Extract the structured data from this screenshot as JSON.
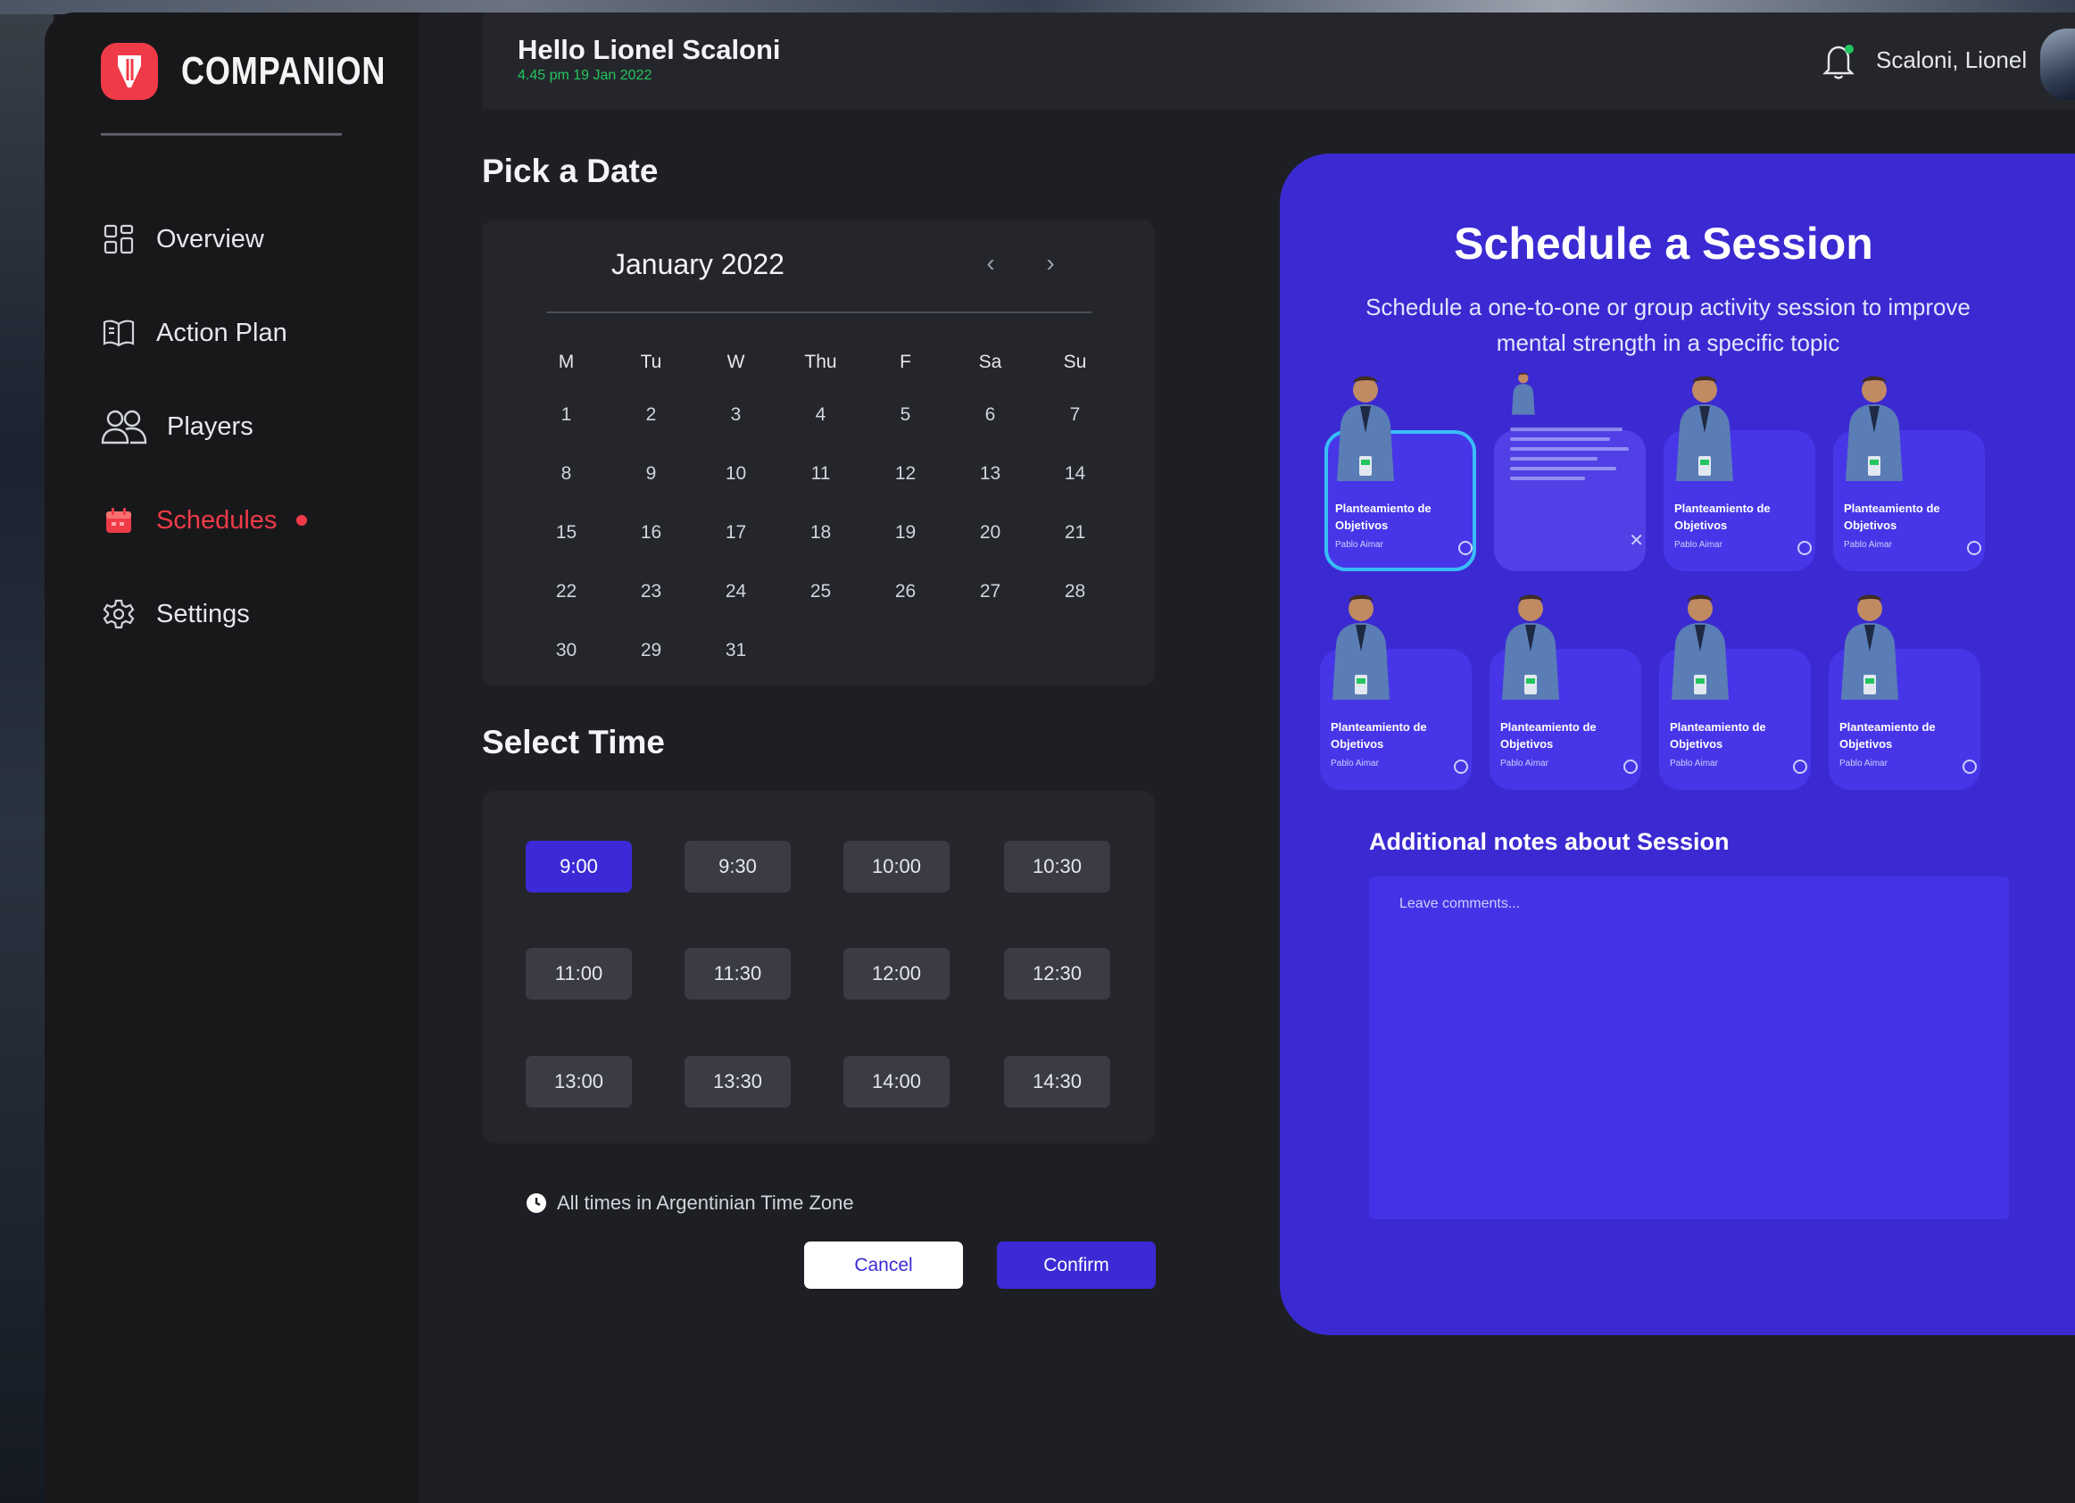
{
  "app": {
    "name": "COMPANION"
  },
  "sidebar": {
    "items": [
      {
        "label": "Overview",
        "icon": "grid-icon",
        "active": false
      },
      {
        "label": "Action Plan",
        "icon": "book-icon",
        "active": false
      },
      {
        "label": "Players",
        "icon": "users-icon",
        "active": false
      },
      {
        "label": "Schedules",
        "icon": "calendar-icon",
        "active": true
      },
      {
        "label": "Settings",
        "icon": "gear-icon",
        "active": false
      }
    ]
  },
  "header": {
    "greeting": "Hello Lionel Scaloni",
    "datetime": "4.45 pm 19 Jan 2022",
    "user_name": "Scaloni, Lionel"
  },
  "date_picker": {
    "title": "Pick a Date",
    "month": "January 2022",
    "weekdays": [
      "M",
      "Tu",
      "W",
      "Thu",
      "F",
      "Sa",
      "Su"
    ],
    "weeks": [
      [
        "1",
        "2",
        "3",
        "4",
        "5",
        "6",
        "7"
      ],
      [
        "8",
        "9",
        "10",
        "11",
        "12",
        "13",
        "14"
      ],
      [
        "15",
        "16",
        "17",
        "18",
        "19",
        "20",
        "21"
      ],
      [
        "22",
        "23",
        "24",
        "25",
        "26",
        "27",
        "28"
      ],
      [
        "30",
        "29",
        "31",
        "",
        "",
        "",
        ""
      ]
    ]
  },
  "time_picker": {
    "title": "Select Time",
    "slots": [
      "9:00",
      "9:30",
      "10:00",
      "10:30",
      "11:00",
      "11:30",
      "12:00",
      "12:30",
      "13:00",
      "13:30",
      "14:00",
      "14:30"
    ],
    "selected": "9:00",
    "timezone_note": "All times in Argentinian Time Zone"
  },
  "actions": {
    "cancel": "Cancel",
    "confirm": "Confirm"
  },
  "session": {
    "title": "Schedule a Session",
    "description": "Schedule a one-to-one or group activity session to improve mental strength in a specific topic",
    "cards": [
      {
        "title": "Planteamiento de Objetivos",
        "subtitle": "Pablo Aimar"
      },
      {
        "title": "",
        "subtitle": ""
      },
      {
        "title": "Planteamiento de Objetivos",
        "subtitle": "Pablo Aimar"
      },
      {
        "title": "Planteamiento de Objetivos",
        "subtitle": "Pablo Aimar"
      },
      {
        "title": "Planteamiento de Objetivos",
        "subtitle": "Pablo Aimar"
      },
      {
        "title": "Planteamiento de Objetivos",
        "subtitle": "Pablo Aimar"
      },
      {
        "title": "Planteamiento de Objetivos",
        "subtitle": "Pablo Aimar"
      },
      {
        "title": "Planteamiento de Objetivos",
        "subtitle": "Pablo Aimar"
      }
    ],
    "selected_card": 0,
    "notes_label": "Additional notes about Session",
    "notes_placeholder": "Leave comments..."
  },
  "colors": {
    "accent": "#3c2ad6",
    "brand": "#ef3b47",
    "panel": "#3b2ad1",
    "status_green": "#22c55e",
    "selection_ring": "#38bdf8"
  }
}
